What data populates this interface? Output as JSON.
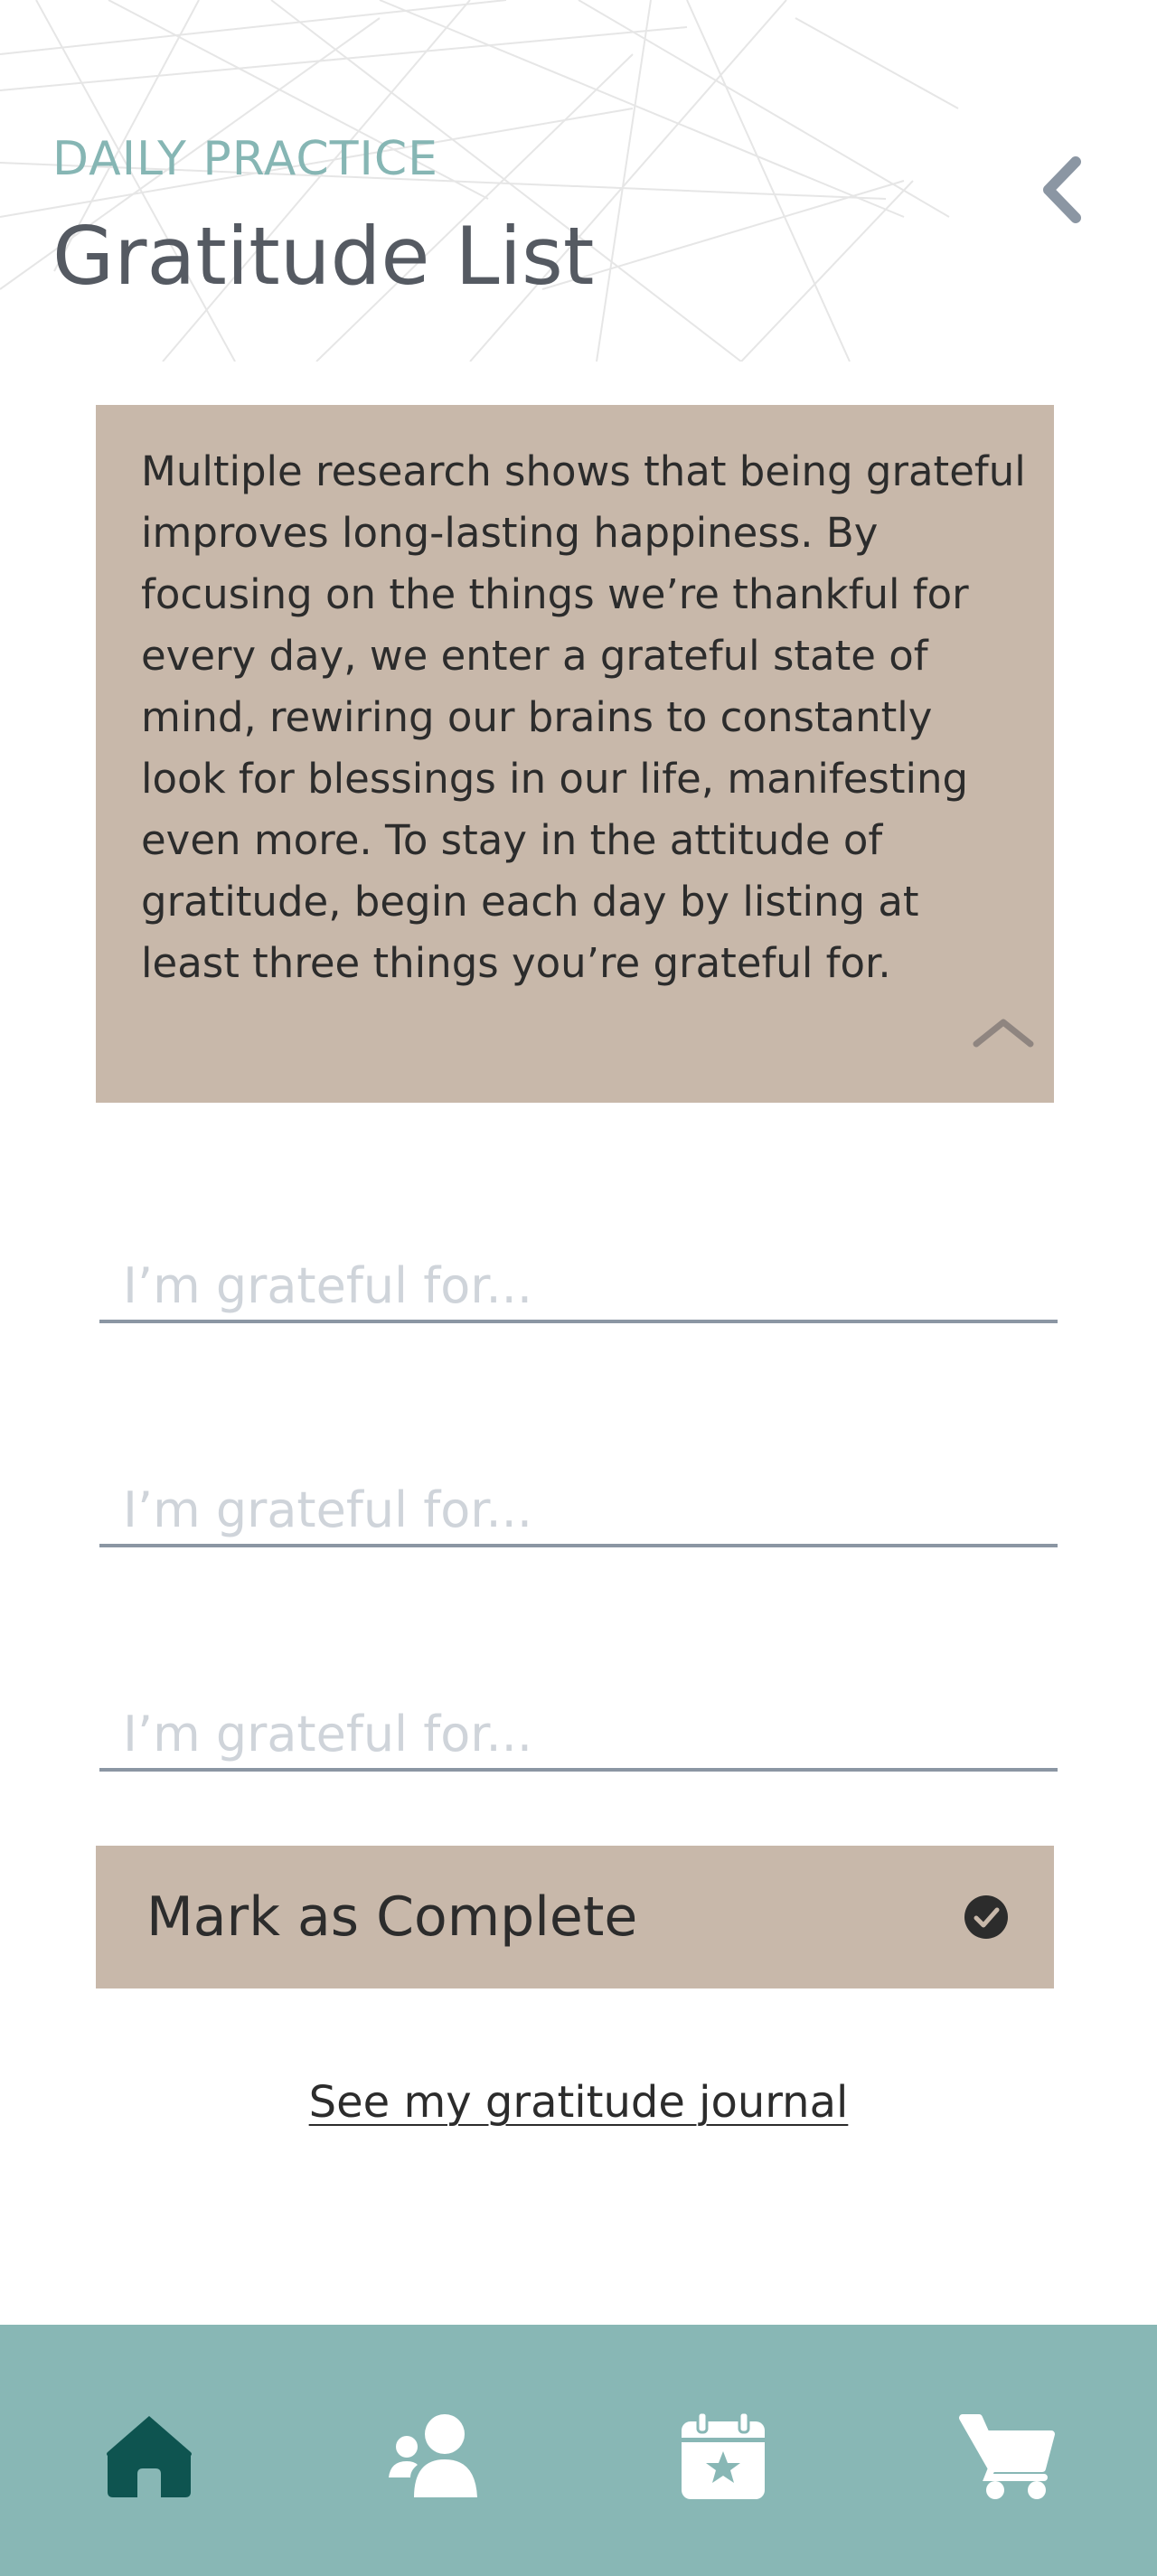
{
  "header": {
    "eyebrow": "DAILY PRACTICE",
    "title": "Gratitude List",
    "back_icon": "chevron-left-icon"
  },
  "info_card": {
    "text": "Multiple research shows that being grateful improves long-lasting happiness. By focusing on the things we’re thankful for every day, we enter a grateful state of mind, rewiring our brains to constantly look for blessings in our life, manifesting even more. To stay in the attitude of gratitude, begin each day by listing at least three things you’re grateful for.",
    "collapse_icon": "chevron-up-icon"
  },
  "gratitude_fields": [
    {
      "placeholder": "I’m grateful for...",
      "value": ""
    },
    {
      "placeholder": "I’m grateful for...",
      "value": ""
    },
    {
      "placeholder": "I’m grateful for...",
      "value": ""
    }
  ],
  "complete_button": {
    "label": "Mark as Complete",
    "icon": "check-circle-icon"
  },
  "journal_link": {
    "label": "See my gratitude journal"
  },
  "bottom_nav": {
    "items": [
      {
        "icon": "home-icon",
        "active": true
      },
      {
        "icon": "community-icon",
        "active": false
      },
      {
        "icon": "calendar-star-icon",
        "active": false
      },
      {
        "icon": "cart-icon",
        "active": false
      }
    ]
  },
  "colors": {
    "accent_teal": "#86b6b4",
    "nav_background": "#88b7b5",
    "nav_active": "#0e5450",
    "card_beige": "#c8b8aa",
    "title_gray": "#555a62"
  }
}
